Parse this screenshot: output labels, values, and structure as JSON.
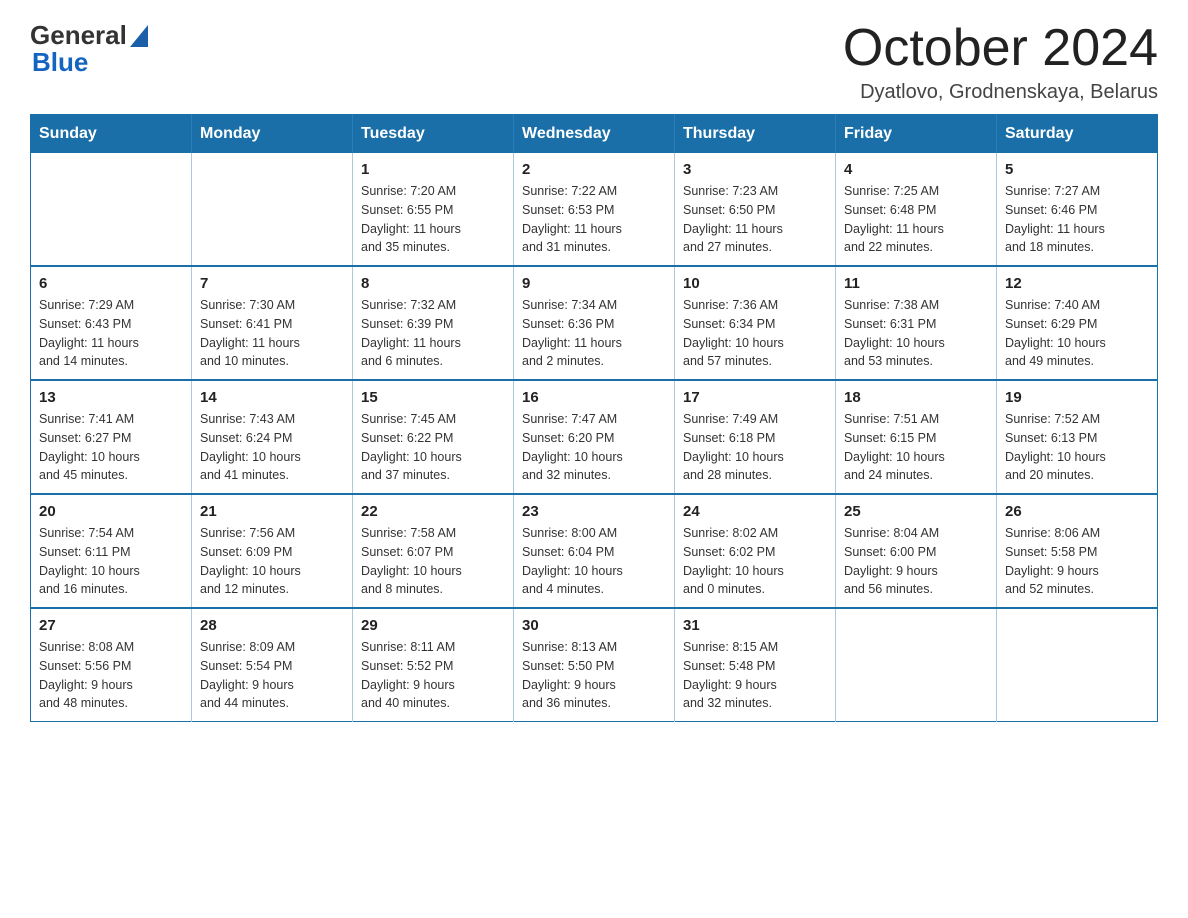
{
  "logo": {
    "line1": "General",
    "line2": "Blue"
  },
  "title": "October 2024",
  "subtitle": "Dyatlovo, Grodnenskaya, Belarus",
  "weekdays": [
    "Sunday",
    "Monday",
    "Tuesday",
    "Wednesday",
    "Thursday",
    "Friday",
    "Saturday"
  ],
  "weeks": [
    [
      {
        "day": "",
        "info": ""
      },
      {
        "day": "",
        "info": ""
      },
      {
        "day": "1",
        "info": "Sunrise: 7:20 AM\nSunset: 6:55 PM\nDaylight: 11 hours\nand 35 minutes."
      },
      {
        "day": "2",
        "info": "Sunrise: 7:22 AM\nSunset: 6:53 PM\nDaylight: 11 hours\nand 31 minutes."
      },
      {
        "day": "3",
        "info": "Sunrise: 7:23 AM\nSunset: 6:50 PM\nDaylight: 11 hours\nand 27 minutes."
      },
      {
        "day": "4",
        "info": "Sunrise: 7:25 AM\nSunset: 6:48 PM\nDaylight: 11 hours\nand 22 minutes."
      },
      {
        "day": "5",
        "info": "Sunrise: 7:27 AM\nSunset: 6:46 PM\nDaylight: 11 hours\nand 18 minutes."
      }
    ],
    [
      {
        "day": "6",
        "info": "Sunrise: 7:29 AM\nSunset: 6:43 PM\nDaylight: 11 hours\nand 14 minutes."
      },
      {
        "day": "7",
        "info": "Sunrise: 7:30 AM\nSunset: 6:41 PM\nDaylight: 11 hours\nand 10 minutes."
      },
      {
        "day": "8",
        "info": "Sunrise: 7:32 AM\nSunset: 6:39 PM\nDaylight: 11 hours\nand 6 minutes."
      },
      {
        "day": "9",
        "info": "Sunrise: 7:34 AM\nSunset: 6:36 PM\nDaylight: 11 hours\nand 2 minutes."
      },
      {
        "day": "10",
        "info": "Sunrise: 7:36 AM\nSunset: 6:34 PM\nDaylight: 10 hours\nand 57 minutes."
      },
      {
        "day": "11",
        "info": "Sunrise: 7:38 AM\nSunset: 6:31 PM\nDaylight: 10 hours\nand 53 minutes."
      },
      {
        "day": "12",
        "info": "Sunrise: 7:40 AM\nSunset: 6:29 PM\nDaylight: 10 hours\nand 49 minutes."
      }
    ],
    [
      {
        "day": "13",
        "info": "Sunrise: 7:41 AM\nSunset: 6:27 PM\nDaylight: 10 hours\nand 45 minutes."
      },
      {
        "day": "14",
        "info": "Sunrise: 7:43 AM\nSunset: 6:24 PM\nDaylight: 10 hours\nand 41 minutes."
      },
      {
        "day": "15",
        "info": "Sunrise: 7:45 AM\nSunset: 6:22 PM\nDaylight: 10 hours\nand 37 minutes."
      },
      {
        "day": "16",
        "info": "Sunrise: 7:47 AM\nSunset: 6:20 PM\nDaylight: 10 hours\nand 32 minutes."
      },
      {
        "day": "17",
        "info": "Sunrise: 7:49 AM\nSunset: 6:18 PM\nDaylight: 10 hours\nand 28 minutes."
      },
      {
        "day": "18",
        "info": "Sunrise: 7:51 AM\nSunset: 6:15 PM\nDaylight: 10 hours\nand 24 minutes."
      },
      {
        "day": "19",
        "info": "Sunrise: 7:52 AM\nSunset: 6:13 PM\nDaylight: 10 hours\nand 20 minutes."
      }
    ],
    [
      {
        "day": "20",
        "info": "Sunrise: 7:54 AM\nSunset: 6:11 PM\nDaylight: 10 hours\nand 16 minutes."
      },
      {
        "day": "21",
        "info": "Sunrise: 7:56 AM\nSunset: 6:09 PM\nDaylight: 10 hours\nand 12 minutes."
      },
      {
        "day": "22",
        "info": "Sunrise: 7:58 AM\nSunset: 6:07 PM\nDaylight: 10 hours\nand 8 minutes."
      },
      {
        "day": "23",
        "info": "Sunrise: 8:00 AM\nSunset: 6:04 PM\nDaylight: 10 hours\nand 4 minutes."
      },
      {
        "day": "24",
        "info": "Sunrise: 8:02 AM\nSunset: 6:02 PM\nDaylight: 10 hours\nand 0 minutes."
      },
      {
        "day": "25",
        "info": "Sunrise: 8:04 AM\nSunset: 6:00 PM\nDaylight: 9 hours\nand 56 minutes."
      },
      {
        "day": "26",
        "info": "Sunrise: 8:06 AM\nSunset: 5:58 PM\nDaylight: 9 hours\nand 52 minutes."
      }
    ],
    [
      {
        "day": "27",
        "info": "Sunrise: 8:08 AM\nSunset: 5:56 PM\nDaylight: 9 hours\nand 48 minutes."
      },
      {
        "day": "28",
        "info": "Sunrise: 8:09 AM\nSunset: 5:54 PM\nDaylight: 9 hours\nand 44 minutes."
      },
      {
        "day": "29",
        "info": "Sunrise: 8:11 AM\nSunset: 5:52 PM\nDaylight: 9 hours\nand 40 minutes."
      },
      {
        "day": "30",
        "info": "Sunrise: 8:13 AM\nSunset: 5:50 PM\nDaylight: 9 hours\nand 36 minutes."
      },
      {
        "day": "31",
        "info": "Sunrise: 8:15 AM\nSunset: 5:48 PM\nDaylight: 9 hours\nand 32 minutes."
      },
      {
        "day": "",
        "info": ""
      },
      {
        "day": "",
        "info": ""
      }
    ]
  ]
}
